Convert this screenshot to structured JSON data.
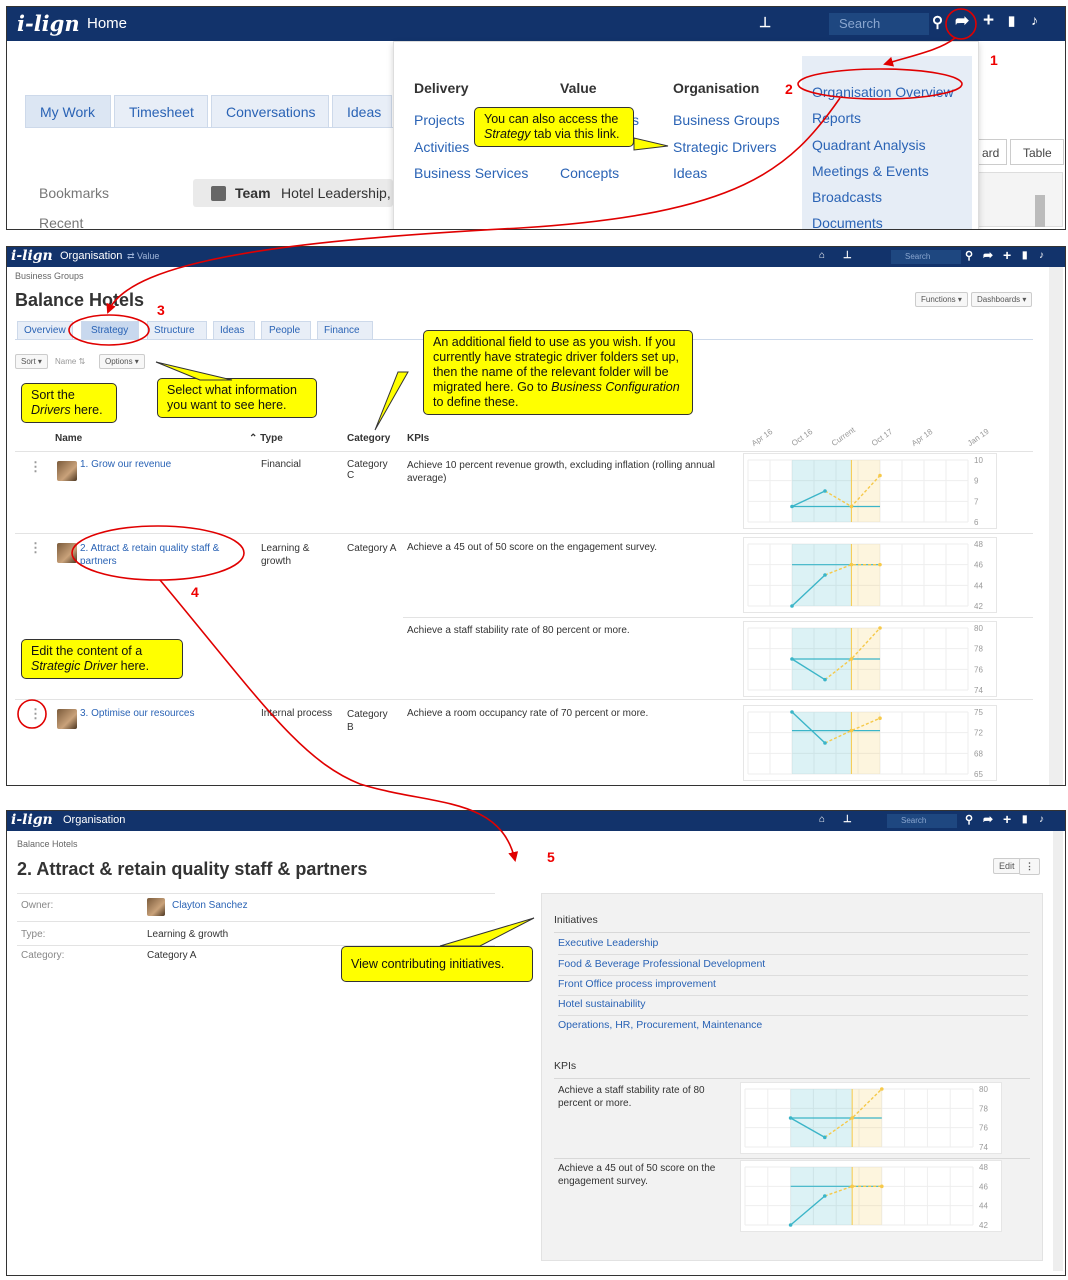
{
  "p1": {
    "logo": "i-lign",
    "home": "Home",
    "search": "Search",
    "tabs": [
      "My Work",
      "Timesheet",
      "Conversations",
      "Ideas"
    ],
    "bookmarks": "Bookmarks",
    "recent": "Recent",
    "team_prefix": "Team",
    "team_name": "Hotel Leadership, V",
    "right_btns": [
      "ard",
      "Table"
    ],
    "menu": {
      "delivery": {
        "heading": "Delivery",
        "items": [
          "Projects",
          "Activities",
          "Business Services"
        ]
      },
      "value": {
        "heading": "Value",
        "items": [
          "s",
          "Concepts"
        ]
      },
      "organisation": {
        "heading": "Organisation",
        "items": [
          "Business Groups",
          "Strategic Drivers",
          "Ideas"
        ]
      },
      "extra": [
        "Organisation Overview",
        "Reports",
        "Quadrant Analysis",
        "Meetings & Events",
        "Broadcasts",
        "Documents"
      ]
    }
  },
  "p2": {
    "logo": "i-lign",
    "section": "Organisation",
    "value_link": "⇄ Value",
    "search": "Search",
    "breadcrumb": "Business Groups",
    "title": "Balance Hotels",
    "tabs": [
      "Overview",
      "Strategy",
      "Structure",
      "Ideas",
      "People",
      "Finance"
    ],
    "functions": "Functions ▾",
    "dashboards": "Dashboards ▾",
    "sort": "Sort ▾",
    "name_sort": "Name ⇅",
    "options": "Options ▾",
    "cols": {
      "name": "Name",
      "type": "Type",
      "category": "Category",
      "kpis": "KPIs"
    },
    "xticks": [
      "Apr 16",
      "Oct 16",
      "Current",
      "Oct 17",
      "Apr 18",
      "Jan 19"
    ],
    "drivers": [
      {
        "name": "1. Grow our revenue",
        "type": "Financial",
        "category": "Category C",
        "kpi": "Achieve 10 percent revenue growth, excluding inflation (rolling annual average)"
      },
      {
        "name": "2. Attract & retain quality staff & partners",
        "type": "Learning & growth",
        "category": "Category A",
        "kpi": "Achieve a 45 out of 50 score on the engagement survey."
      },
      {
        "kpi": "Achieve a staff stability rate of 80 percent or more."
      },
      {
        "name": "3. Optimise our resources",
        "type": "Internal process",
        "category": "Category B",
        "kpi": "Achieve a room occupancy rate of 70 percent or more."
      }
    ]
  },
  "p3": {
    "logo": "i-lign",
    "section": "Organisation",
    "search": "Search",
    "breadcrumb": "Balance Hotels",
    "title": "2. Attract & retain quality staff & partners",
    "edit": "Edit",
    "owner_label": "Owner:",
    "owner": "Clayton Sanchez",
    "type_label": "Type:",
    "type": "Learning & growth",
    "category_label": "Category:",
    "category": "Category A",
    "initiatives_heading": "Initiatives",
    "initiatives": [
      "Executive Leadership",
      "Food & Beverage Professional Development",
      "Front Office process improvement",
      "Hotel sustainability",
      "Operations, HR, Procurement, Maintenance"
    ],
    "kpis_heading": "KPIs",
    "kpis": [
      "Achieve a staff stability rate of 80 percent or more.",
      "Achieve a 45 out of 50 score on the engagement survey."
    ]
  },
  "callouts": {
    "strategy": {
      "pre": "You can also access the ",
      "em": "Strategy",
      "post": " tab via this link."
    },
    "field": {
      "pre": "An additional field to use as you wish.  If you currently have strategic driver folders set up, then the name of the relevant folder will be migrated here. Go to ",
      "em": "Business Configuration",
      "post": " to define these."
    },
    "sort": {
      "pre": "Sort the ",
      "em": "Drivers",
      "post": " here."
    },
    "select": {
      "text": "Select what information you want to see here."
    },
    "edit": {
      "pre": "Edit the content of a ",
      "em": "Strategic Driver",
      "post": " here."
    },
    "initiatives": {
      "text": "View contributing initiatives."
    }
  },
  "step_numbers": [
    "1",
    "2",
    "3",
    "4",
    "5"
  ],
  "colors": {
    "navy": "#12336b",
    "link": "#2a63b5",
    "callout": "#ffff00",
    "annotation": "#e00000",
    "actual": "#3bb5c8",
    "target": "#f6c94a"
  },
  "chart_data": [
    {
      "type": "line",
      "title": "Achieve 10 percent revenue growth, excluding inflation (rolling annual average)",
      "ylim": [
        6,
        10
      ],
      "series": [
        {
          "values": [
            7,
            8,
            7,
            9
          ]
        }
      ]
    },
    {
      "type": "line",
      "title": "Achieve a 45 out of 50 score on the engagement survey.",
      "ylim": [
        42,
        48
      ],
      "series": [
        {
          "values": [
            42,
            45,
            46,
            46
          ]
        }
      ]
    },
    {
      "type": "line",
      "title": "Achieve a staff stability rate of 80 percent or more.",
      "ylim": [
        74,
        80
      ],
      "series": [
        {
          "values": [
            77,
            75,
            77,
            80
          ]
        }
      ]
    },
    {
      "type": "line",
      "title": "Achieve a room occupancy rate of 70 percent or more.",
      "ylim": [
        65,
        75
      ],
      "series": [
        {
          "values": [
            75,
            70,
            72,
            74
          ]
        }
      ]
    }
  ]
}
